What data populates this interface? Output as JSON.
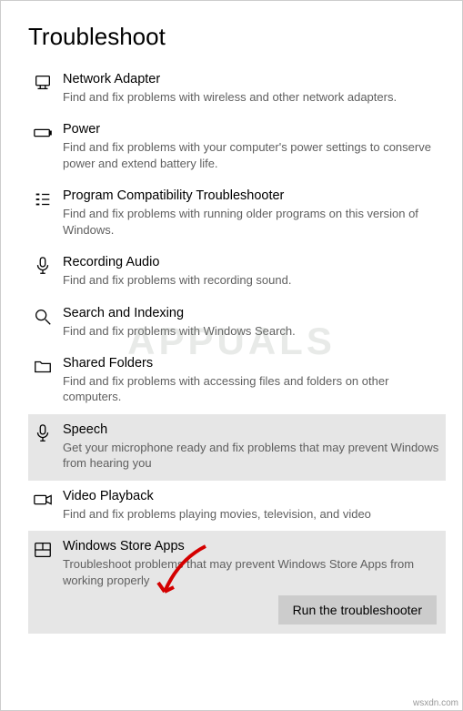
{
  "page": {
    "title": "Troubleshoot"
  },
  "troubleshooters": [
    {
      "icon": "network-adapter-icon",
      "title": "Network Adapter",
      "desc": "Find and fix problems with wireless and other network adapters.",
      "state": "normal"
    },
    {
      "icon": "power-icon",
      "title": "Power",
      "desc": "Find and fix problems with your computer's power settings to conserve power and extend battery life.",
      "state": "normal"
    },
    {
      "icon": "compatibility-icon",
      "title": "Program Compatibility Troubleshooter",
      "desc": "Find and fix problems with running older programs on this version of Windows.",
      "state": "normal"
    },
    {
      "icon": "microphone-icon",
      "title": "Recording Audio",
      "desc": "Find and fix problems with recording sound.",
      "state": "normal"
    },
    {
      "icon": "search-icon",
      "title": "Search and Indexing",
      "desc": "Find and fix problems with Windows Search.",
      "state": "normal"
    },
    {
      "icon": "folder-icon",
      "title": "Shared Folders",
      "desc": "Find and fix problems with accessing files and folders on other computers.",
      "state": "normal"
    },
    {
      "icon": "microphone-icon",
      "title": "Speech",
      "desc": "Get your microphone ready and fix problems that may prevent Windows from hearing you",
      "state": "selected"
    },
    {
      "icon": "video-icon",
      "title": "Video Playback",
      "desc": "Find and fix problems playing movies, television, and video",
      "state": "normal"
    },
    {
      "icon": "store-icon",
      "title": "Windows Store Apps",
      "desc": "Troubleshoot problems that may prevent Windows Store Apps from working properly",
      "state": "active"
    }
  ],
  "buttons": {
    "run": "Run the troubleshooter"
  },
  "watermark": "APPUALS",
  "footer": "wsxdn.com"
}
